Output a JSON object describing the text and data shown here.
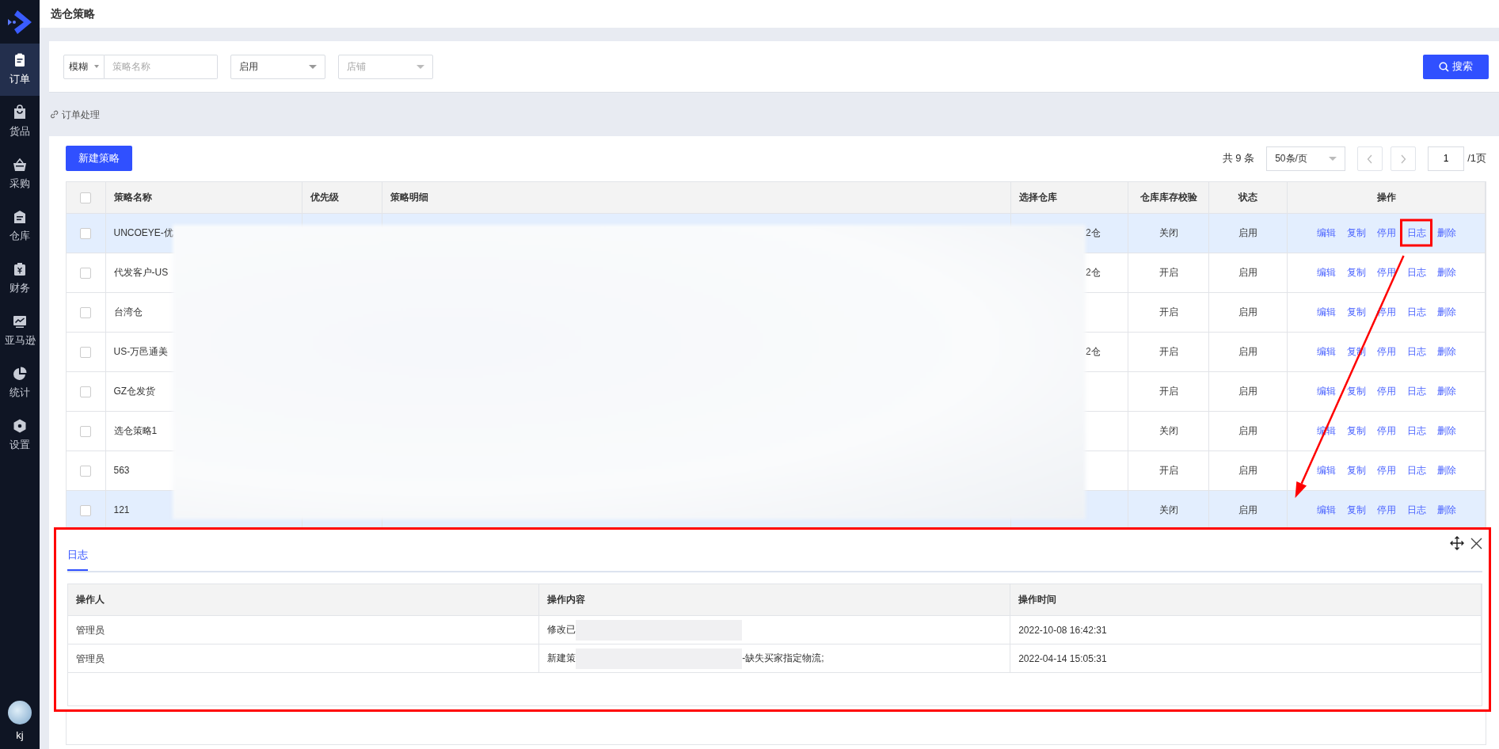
{
  "sidebar": {
    "items": [
      {
        "label": "订单",
        "selected": true
      },
      {
        "label": "货品",
        "selected": false
      },
      {
        "label": "采购",
        "selected": false
      },
      {
        "label": "仓库",
        "selected": false
      },
      {
        "label": "财务",
        "selected": false
      },
      {
        "label": "亚马逊",
        "selected": false
      },
      {
        "label": "统计",
        "selected": false
      },
      {
        "label": "设置",
        "selected": false
      }
    ],
    "user": {
      "name": "kj"
    }
  },
  "header": {
    "title": "选仓策略"
  },
  "filters": {
    "match_mode": "模糊",
    "name_field": {
      "placeholder": "策略名称"
    },
    "status_select": {
      "value": "启用"
    },
    "shop_select": {
      "placeholder": "店铺"
    },
    "search_button": "搜索"
  },
  "breadcrumb": "订单处理",
  "toolbar": {
    "new_button": "新建策略",
    "total": "共 9 条",
    "page_size": "50条/页",
    "page": "1",
    "page_count": "/1页"
  },
  "table": {
    "all_checked": false,
    "redacted": true,
    "columns": [
      "策略名称",
      "优先级",
      "策略明细",
      "选择仓库",
      "仓库库存校验",
      "状态",
      "操作"
    ],
    "rows": [
      {
        "checked": false,
        "highlighted": true,
        "log_marked": true,
        "name": "UNCOEYE-优",
        "warehouse": "2仓",
        "stock_check": "关闭",
        "status": "启用",
        "actions": [
          "编辑",
          "复制",
          "停用",
          "日志",
          "删除"
        ]
      },
      {
        "checked": false,
        "highlighted": false,
        "log_marked": false,
        "name": "代发客户-US",
        "warehouse": "2仓",
        "stock_check": "开启",
        "status": "启用",
        "actions": [
          "编辑",
          "复制",
          "停用",
          "日志",
          "删除"
        ]
      },
      {
        "checked": false,
        "highlighted": false,
        "log_marked": false,
        "name": "台湾仓",
        "stock_check": "开启",
        "status": "启用",
        "actions": [
          "编辑",
          "复制",
          "停用",
          "日志",
          "删除"
        ]
      },
      {
        "checked": false,
        "highlighted": false,
        "log_marked": false,
        "name": "US-万邑通美",
        "warehouse": "2仓",
        "stock_check": "开启",
        "status": "启用",
        "actions": [
          "编辑",
          "复制",
          "停用",
          "日志",
          "删除"
        ]
      },
      {
        "checked": false,
        "highlighted": false,
        "log_marked": false,
        "name": "GZ仓发货",
        "stock_check": "开启",
        "status": "启用",
        "actions": [
          "编辑",
          "复制",
          "停用",
          "日志",
          "删除"
        ]
      },
      {
        "checked": false,
        "highlighted": false,
        "log_marked": false,
        "name": "选仓策略1",
        "stock_check": "关闭",
        "status": "启用",
        "actions": [
          "编辑",
          "复制",
          "停用",
          "日志",
          "删除"
        ]
      },
      {
        "checked": false,
        "highlighted": false,
        "log_marked": false,
        "name": "563",
        "stock_check": "开启",
        "status": "启用",
        "actions": [
          "编辑",
          "复制",
          "停用",
          "日志",
          "删除"
        ]
      },
      {
        "checked": false,
        "highlighted": true,
        "log_marked": false,
        "name": "121",
        "stock_check": "关闭",
        "status": "启用",
        "actions": [
          "编辑",
          "复制",
          "停用",
          "日志",
          "删除"
        ]
      }
    ]
  },
  "log_panel": {
    "marked": true,
    "tabs": [
      {
        "label": "日志",
        "selected": true
      }
    ],
    "columns": [
      "操作人",
      "操作内容",
      "操作时间"
    ],
    "rows": [
      {
        "operator": "管理员",
        "content_start": "修改已",
        "redacted": true,
        "time": "2022-10-08 16:42:31"
      },
      {
        "operator": "管理员",
        "content_start": "新建策",
        "redacted": true,
        "content_end": "-缺失买家指定物流;",
        "time": "2022-04-14 15:05:31"
      }
    ]
  },
  "annotation_arrow": true
}
